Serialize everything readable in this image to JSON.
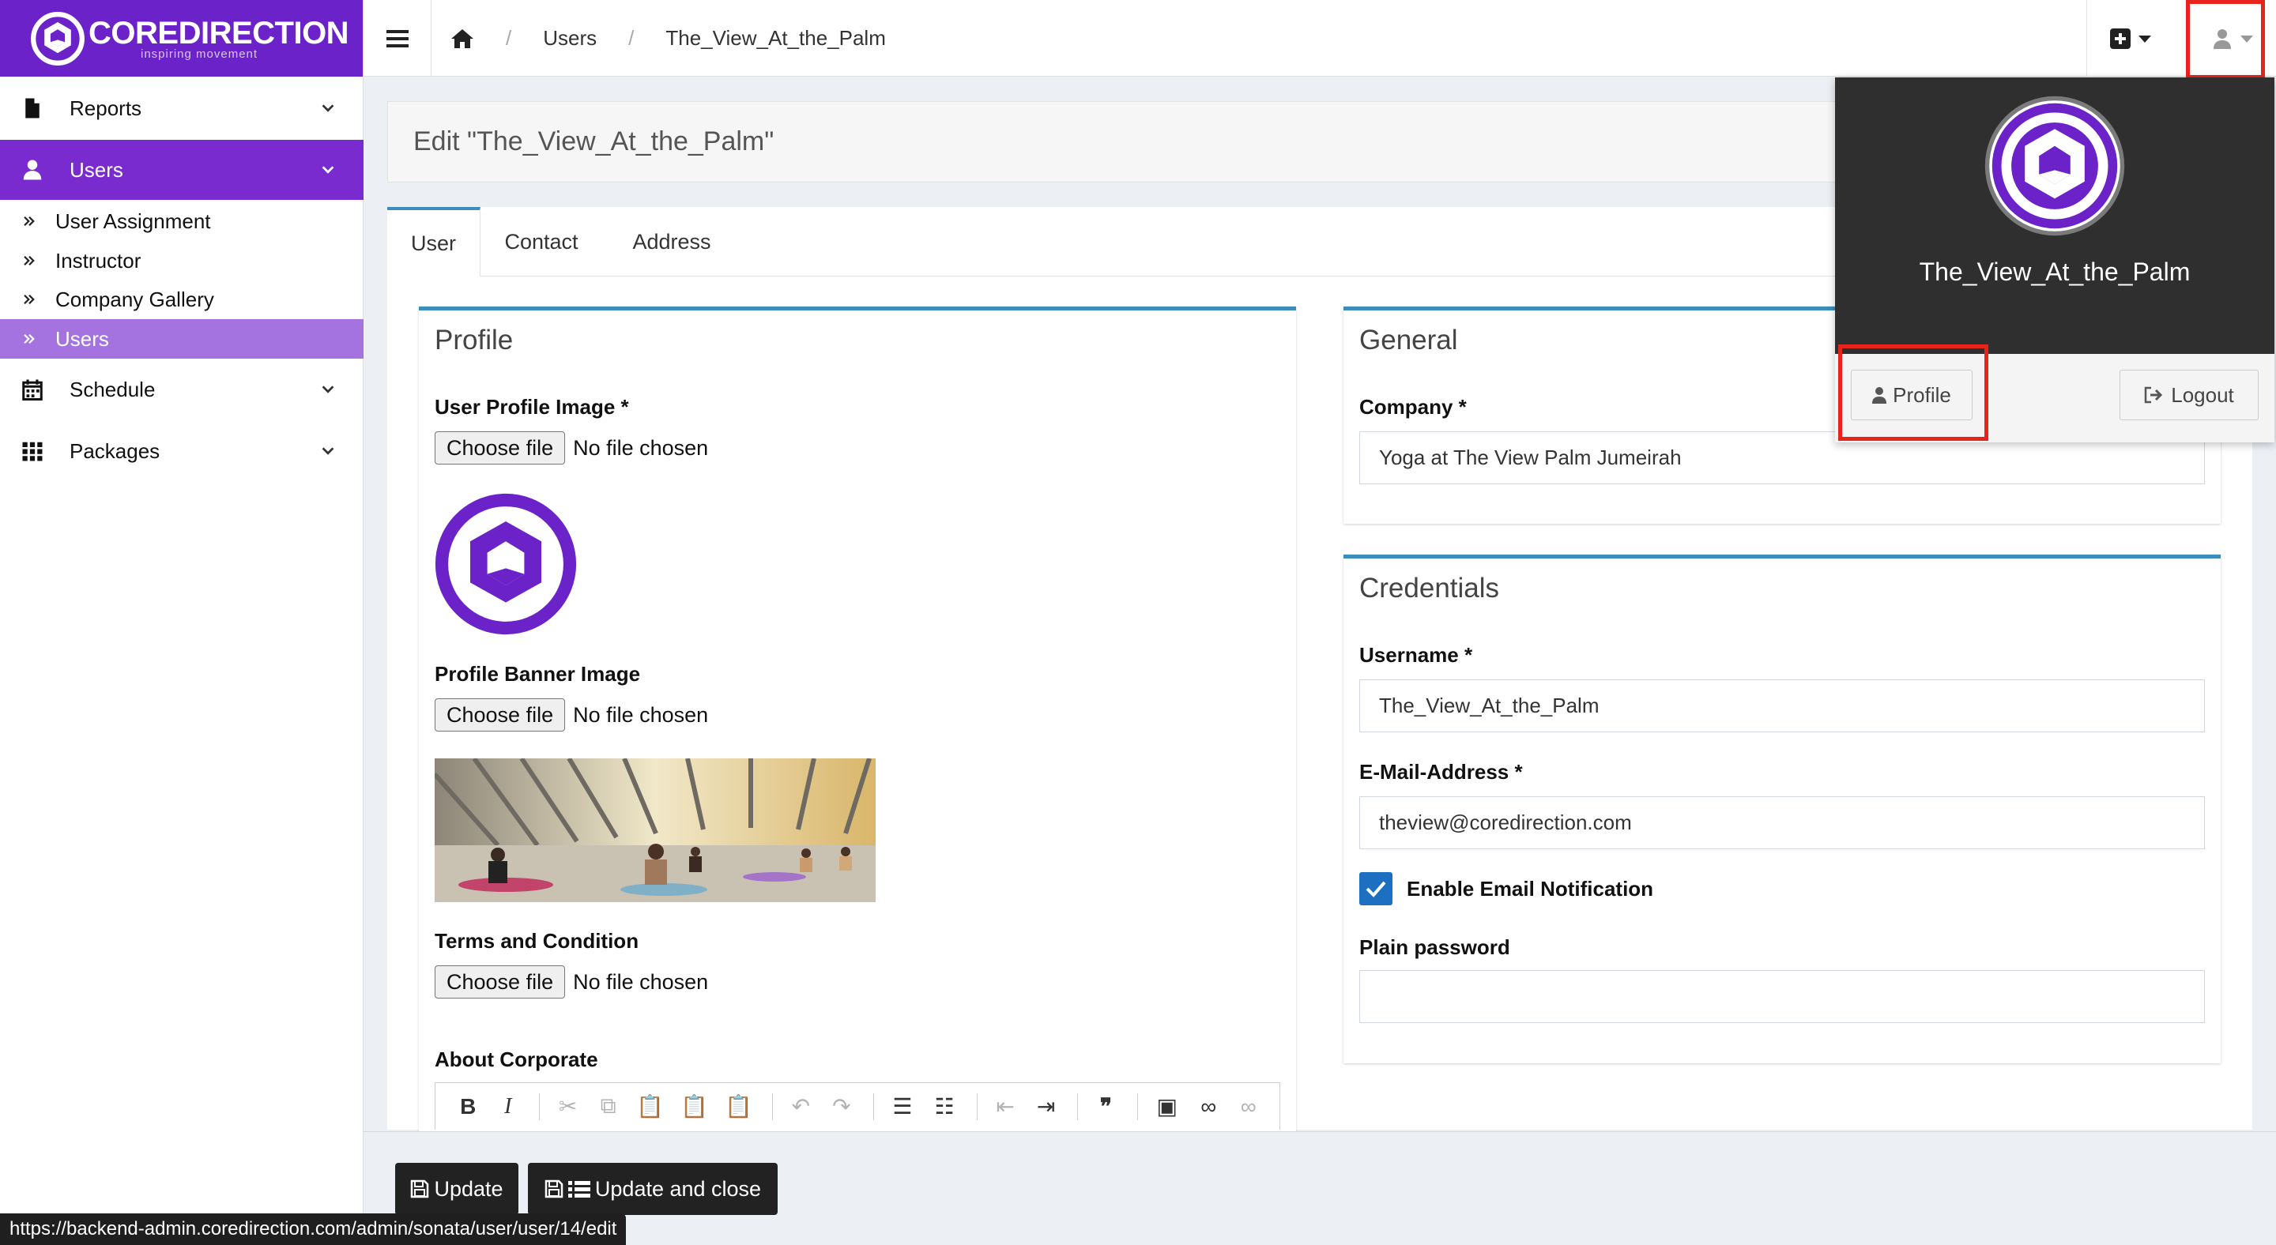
{
  "brand": {
    "name": "COREDIRECTION",
    "tagline": "inspiring movement",
    "color": "#6b22c8"
  },
  "sidebar": {
    "items": [
      {
        "label": "Reports",
        "icon": "file-icon"
      },
      {
        "label": "Users",
        "icon": "user-icon"
      },
      {
        "label": "Schedule",
        "icon": "calendar-icon"
      },
      {
        "label": "Packages",
        "icon": "grid-icon"
      }
    ],
    "users_sub": [
      {
        "label": "User Assignment"
      },
      {
        "label": "Instructor"
      },
      {
        "label": "Company Gallery"
      },
      {
        "label": "Users"
      }
    ]
  },
  "breadcrumb": {
    "items": [
      "Users",
      "The_View_At_the_Palm"
    ]
  },
  "page": {
    "title": "Edit \"The_View_At_the_Palm\""
  },
  "tabs": [
    "User",
    "Contact",
    "Address"
  ],
  "profile": {
    "title": "Profile",
    "profile_image_label": "User Profile Image *",
    "banner_image_label": "Profile Banner Image",
    "terms_label": "Terms and Condition",
    "about_label": "About Corporate",
    "choose_file": "Choose file",
    "no_file": "No file chosen"
  },
  "general": {
    "title": "General",
    "company_label": "Company *",
    "company_value": "Yoga at The View Palm Jumeirah"
  },
  "credentials": {
    "title": "Credentials",
    "username_label": "Username *",
    "username_value": "The_View_At_the_Palm",
    "email_label": "E-Mail-Address *",
    "email_value": "theview@coredirection.com",
    "notify_label": "Enable Email Notification",
    "notify_checked": true,
    "password_label": "Plain password",
    "password_value": ""
  },
  "actions": {
    "update": "Update",
    "update_close": "Update and close"
  },
  "user_menu": {
    "name": "The_View_At_the_Palm",
    "profile": "Profile",
    "logout": "Logout"
  },
  "status_url": "https://backend-admin.coredirection.com/admin/sonata/user/user/14/edit",
  "colors": {
    "accent": "#7a2bd0",
    "sub_active": "#a473df",
    "box_border": "#3c8dbc",
    "highlight": "#e8231b",
    "checkbox": "#1d6fc2"
  }
}
